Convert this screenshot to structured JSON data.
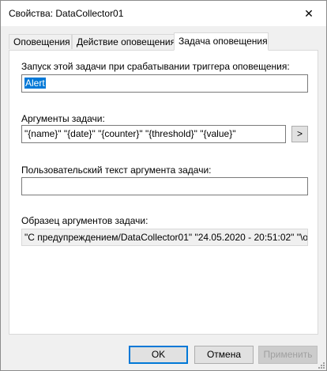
{
  "window": {
    "title": "Свойства: DataCollector01",
    "close_glyph": "✕"
  },
  "tabs": [
    {
      "label": "Оповещения",
      "active": false
    },
    {
      "label": "Действие оповещения",
      "active": false
    },
    {
      "label": "Задача оповещения",
      "active": true
    }
  ],
  "task_panel": {
    "run_task_label": "Запуск этой задачи при срабатывании триггера оповещения:",
    "run_task_value": "Alert",
    "args_label": "Аргументы задачи:",
    "args_value": "\"{name}\" \"{date}\" \"{counter}\" \"{threshold}\" \"{value}\"",
    "args_button": ">",
    "custom_text_label": "Пользовательский текст аргумента задачи:",
    "custom_text_value": "",
    "sample_label": "Образец аргументов задачи:",
    "sample_value": "\"С предупреждением/DataCollector01\" \"24.05.2020 - 20:51:02\" \"\\об..."
  },
  "buttons": {
    "ok": "OK",
    "cancel": "Отмена",
    "apply": "Применить"
  }
}
